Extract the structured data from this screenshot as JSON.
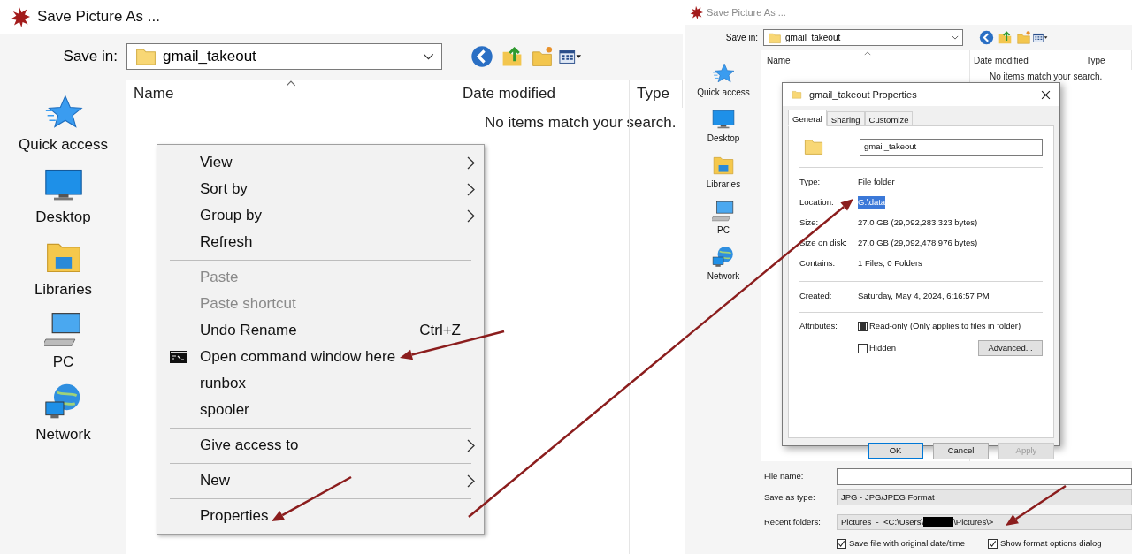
{
  "left": {
    "window": {
      "title": "Save Picture As ..."
    },
    "save_in": {
      "label": "Save in:",
      "value": "gmail_takeout"
    },
    "places": [
      {
        "label": "Quick access",
        "kind": "star"
      },
      {
        "label": "Desktop",
        "kind": "desktop"
      },
      {
        "label": "Libraries",
        "kind": "libraries"
      },
      {
        "label": "PC",
        "kind": "pc"
      },
      {
        "label": "Network",
        "kind": "network"
      }
    ],
    "columns": [
      "Name",
      "Date modified",
      "Type"
    ],
    "empty_message": "No items match your search.",
    "context_menu": [
      {
        "kind": "item",
        "label": "View",
        "disabled": false,
        "submenu": true
      },
      {
        "kind": "item",
        "label": "Sort by",
        "disabled": false,
        "submenu": true
      },
      {
        "kind": "item",
        "label": "Group by",
        "disabled": false,
        "submenu": true
      },
      {
        "kind": "item",
        "label": "Refresh",
        "disabled": false,
        "submenu": false
      },
      {
        "kind": "separator"
      },
      {
        "kind": "item",
        "label": "Paste",
        "disabled": true,
        "submenu": false
      },
      {
        "kind": "item",
        "label": "Paste shortcut",
        "disabled": true,
        "submenu": false
      },
      {
        "kind": "item",
        "label": "Undo Rename",
        "disabled": false,
        "submenu": false,
        "shortcut": "Ctrl+Z"
      },
      {
        "kind": "command",
        "label": "Open command window here",
        "disabled": false,
        "submenu": false
      },
      {
        "kind": "item",
        "label": "runbox",
        "disabled": false,
        "submenu": false
      },
      {
        "kind": "item",
        "label": "spooler",
        "disabled": false,
        "submenu": false
      },
      {
        "kind": "separator"
      },
      {
        "kind": "item",
        "label": "Give access to",
        "disabled": false,
        "submenu": true
      },
      {
        "kind": "separator"
      },
      {
        "kind": "item",
        "label": "New",
        "disabled": false,
        "submenu": true
      },
      {
        "kind": "separator"
      },
      {
        "kind": "item",
        "label": "Properties",
        "disabled": false,
        "submenu": false
      }
    ]
  },
  "right": {
    "window": {
      "title": "Save Picture As ..."
    },
    "save_in": {
      "label": "Save in:",
      "value": "gmail_takeout"
    },
    "places": [
      {
        "label": "Quick access",
        "kind": "star"
      },
      {
        "label": "Desktop",
        "kind": "desktop"
      },
      {
        "label": "Libraries",
        "kind": "libraries"
      },
      {
        "label": "PC",
        "kind": "pc"
      },
      {
        "label": "Network",
        "kind": "network"
      }
    ],
    "columns": [
      "Name",
      "Date modified",
      "Type"
    ],
    "empty_message": "No items match your search.",
    "properties_dialog": {
      "title": "gmail_takeout Properties",
      "tabs": [
        {
          "label": "General",
          "selected": true
        },
        {
          "label": "Sharing",
          "selected": false
        },
        {
          "label": "Customize",
          "selected": false
        }
      ],
      "name": "gmail_takeout",
      "groups": [
        [
          {
            "label": "Type:",
            "value": "File folder",
            "selected": false
          },
          {
            "label": "Location:",
            "value": "G:\\data",
            "selected": true
          },
          {
            "label": "Size:",
            "value": "27.0 GB (29,092,283,323 bytes)",
            "selected": false
          },
          {
            "label": "Size on disk:",
            "value": "27.0 GB (29,092,478,976 bytes)",
            "selected": false
          },
          {
            "label": "Contains:",
            "value": "1 Files, 0 Folders",
            "selected": false
          }
        ],
        [
          {
            "label": "Created:",
            "value": "Saturday, May 4, 2024, 6:16:57 PM",
            "selected": false
          }
        ]
      ],
      "attributes_label": "Attributes:",
      "attributes": [
        {
          "label": "Read-only (Only applies to files in folder)",
          "checked": true
        },
        {
          "label": "Hidden",
          "checked": false
        }
      ],
      "advanced_button": "Advanced...",
      "buttons": [
        {
          "label": "OK",
          "default": true,
          "disabled": false
        },
        {
          "label": "Cancel",
          "default": false,
          "disabled": false
        },
        {
          "label": "Apply",
          "default": false,
          "disabled": true
        }
      ]
    },
    "file_name": {
      "label": "File name:"
    },
    "save_as_type": {
      "label": "Save as type:",
      "value": "JPG - JPG/JPEG Format"
    },
    "recent_folders": {
      "label": "Recent folders:",
      "value_before": "Pictures  -  <C:\\Users\\",
      "redacted": true,
      "value_after": "\\Pictures\\>"
    },
    "options": [
      {
        "label": "Save file with original date/time",
        "checked": true
      },
      {
        "label": "Show format options dialog",
        "checked": true
      }
    ]
  }
}
